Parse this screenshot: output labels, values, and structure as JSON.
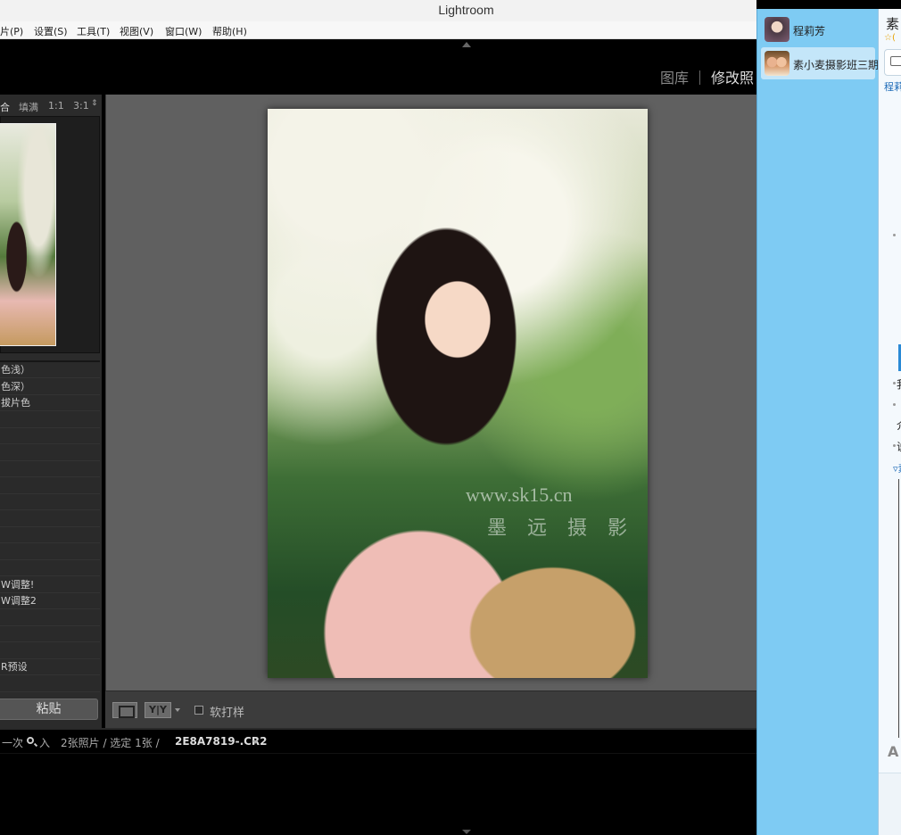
{
  "window": {
    "title": "Lightroom"
  },
  "menu": [
    "片(P)",
    "设置(S)",
    "工具(T)",
    "视图(V)",
    "窗口(W)",
    "帮助(H)"
  ],
  "modules": {
    "library": "图库",
    "develop": "修改照"
  },
  "navigator": {
    "header": {
      "fit": "合",
      "fill": "填满",
      "one_to_one": "1:1",
      "ratio": "3:1"
    }
  },
  "presets": [
    "色浅）",
    "色深）",
    "拔片色",
    "",
    "",
    "",
    "",
    "",
    "",
    "",
    "",
    "",
    "",
    "W调整!",
    "W调整2",
    "",
    "",
    "",
    "R预设",
    ""
  ],
  "left_panel": {
    "paste_label": "粘贴"
  },
  "photo": {
    "watermark_url": "www.sk15.cn",
    "watermark_text": "墨 远 摄 影"
  },
  "toolbar": {
    "yy_label": "Y|Y",
    "soft_proof_label": "软打样"
  },
  "filmstrip": {
    "prev_import_prefix": "一次",
    "prev_import_suffix": "入",
    "count_text": "2张照片 / 选定 1张 /",
    "filename": "2E8A7819-.CR2"
  },
  "qq": {
    "contacts": [
      {
        "name": "程莉芳",
        "selected": false
      },
      {
        "name": "素小麦摄影班三期",
        "selected": true
      }
    ],
    "chat_title": "素",
    "star_text": "☆(",
    "link_text": "程莉",
    "text_1": "我",
    "text_2": "介",
    "text_3": "说",
    "group_label": "▿素",
    "font_button": "A"
  },
  "colors": {
    "qq_blue": "#7ecbf3",
    "lr_panel": "#2b2b2b",
    "lr_canvas": "#606060"
  }
}
